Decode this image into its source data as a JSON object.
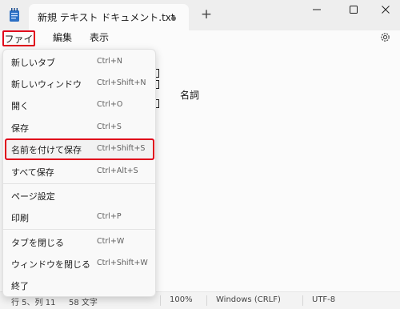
{
  "window": {
    "tab_title": "新規 テキスト ドキュメント.txt",
    "new_tab_glyph": "+",
    "icons": [
      "notepad-icon",
      "unsaved-dot-icon",
      "minimize-icon",
      "maximize-icon",
      "close-icon",
      "gear-icon"
    ]
  },
  "menubar": {
    "file": "ファイル",
    "edit": "編集",
    "view": "表示"
  },
  "editor": {
    "visible_text": "名詞"
  },
  "file_menu": {
    "items": [
      {
        "label": "新しいタブ",
        "shortcut": "Ctrl+N"
      },
      {
        "label": "新しいウィンドウ",
        "shortcut": "Ctrl+Shift+N"
      },
      {
        "label": "開く",
        "shortcut": "Ctrl+O"
      },
      {
        "label": "保存",
        "shortcut": "Ctrl+S"
      },
      {
        "label": "名前を付けて保存",
        "shortcut": "Ctrl+Shift+S"
      },
      {
        "label": "すべて保存",
        "shortcut": "Ctrl+Alt+S"
      },
      {
        "label": "ページ設定",
        "shortcut": ""
      },
      {
        "label": "印刷",
        "shortcut": "Ctrl+P"
      },
      {
        "label": "タブを閉じる",
        "shortcut": "Ctrl+W"
      },
      {
        "label": "ウィンドウを閉じる",
        "shortcut": "Ctrl+Shift+W"
      },
      {
        "label": "終了",
        "shortcut": ""
      }
    ]
  },
  "statusbar": {
    "position": "行 5、列 11",
    "chars": "58 文字",
    "zoom": "100%",
    "line_ending": "Windows (CRLF)",
    "encoding": "UTF-8"
  },
  "colors": {
    "highlight_border": "#e0001b",
    "titlebar": "#eeeeee",
    "tab": "#fbfbfb"
  }
}
